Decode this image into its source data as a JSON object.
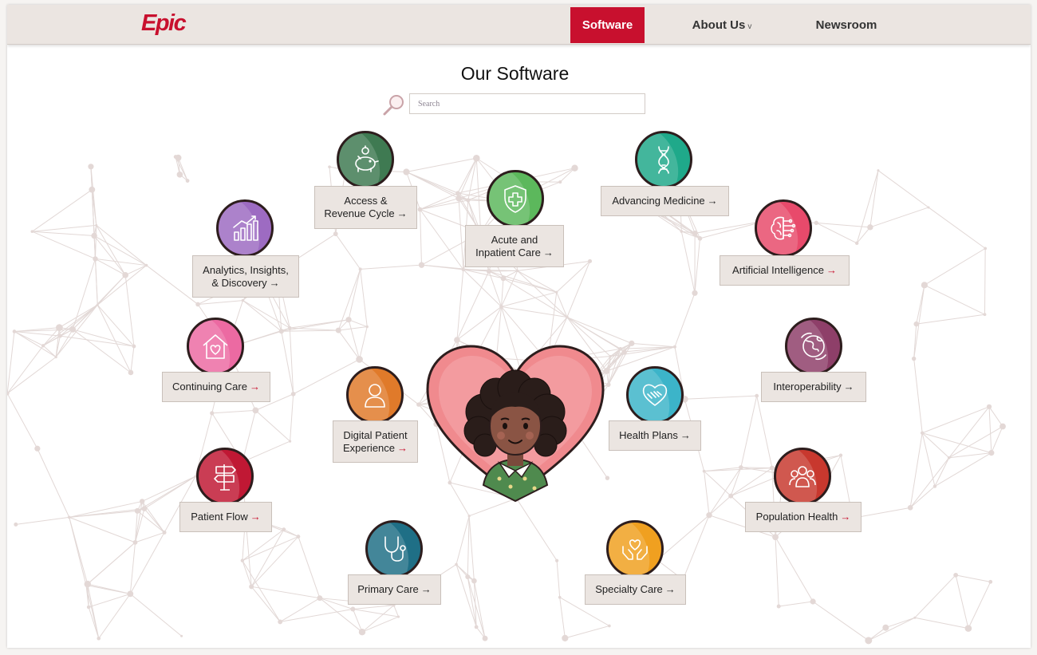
{
  "brand": {
    "logo_text": "Epic",
    "accent": "#c8102e"
  },
  "nav": {
    "software": "Software",
    "about": "About Us",
    "about_chevron": "v",
    "newsroom": "Newsroom"
  },
  "page": {
    "title": "Our Software"
  },
  "search": {
    "placeholder": "Search",
    "value": ""
  },
  "items": {
    "access": {
      "line1": "Access &",
      "line2": "Revenue Cycle",
      "arrow": "→",
      "icon": "piggy-bank-icon",
      "color": "#3f7a52"
    },
    "acute": {
      "line1": "Acute and",
      "line2": "Inpatient Care",
      "arrow": "→",
      "icon": "shield-plus-icon",
      "color": "#5cb85c"
    },
    "advancing": {
      "label": "Advancing Medicine",
      "arrow": "→",
      "icon": "dna-icon",
      "color": "#1fa98a"
    },
    "analytics": {
      "line1": "Analytics, Insights,",
      "line2": "& Discovery",
      "arrow": "→",
      "icon": "bar-chart-icon",
      "color": "#9d6bc2"
    },
    "ai": {
      "label": "Artificial Intelligence",
      "arrow": "→",
      "icon": "brain-circuit-icon",
      "color": "#e84a6b"
    },
    "continuing": {
      "label": "Continuing Care",
      "arrow": "→",
      "icon": "house-heart-icon",
      "color": "#ec6aa2"
    },
    "interop": {
      "label": "Interoperability",
      "arrow": "→",
      "icon": "globe-network-icon",
      "color": "#8e3f69"
    },
    "digital": {
      "line1": "Digital Patient",
      "line2": "Experience",
      "arrow": "→",
      "icon": "person-icon",
      "color": "#e07a2a"
    },
    "healthplans": {
      "label": "Health Plans",
      "arrow": "→",
      "icon": "handshake-icon",
      "color": "#3cb4c9"
    },
    "patientflow": {
      "label": "Patient Flow",
      "arrow": "→",
      "icon": "signpost-icon",
      "color": "#c01834"
    },
    "population": {
      "label": "Population Health",
      "arrow": "→",
      "icon": "people-group-icon",
      "color": "#c8382e"
    },
    "primary": {
      "label": "Primary Care",
      "arrow": "→",
      "icon": "stethoscope-icon",
      "color": "#1f6f86"
    },
    "specialty": {
      "label": "Specialty Care",
      "arrow": "→",
      "icon": "hands-heart-icon",
      "color": "#f0a020"
    }
  },
  "hero": {
    "icon": "patient-heart-illustration"
  }
}
